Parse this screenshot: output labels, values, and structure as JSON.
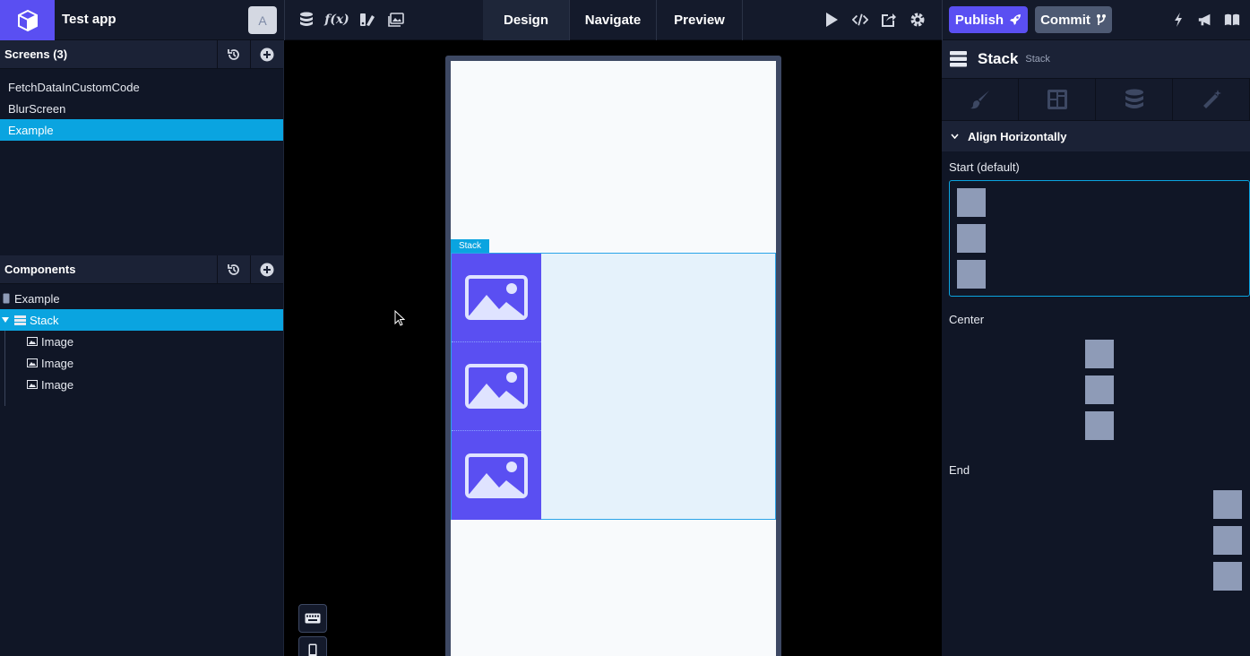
{
  "header": {
    "app_title": "Test app",
    "avatar_letter": "A",
    "tabs": [
      {
        "label": "Design",
        "active": true
      },
      {
        "label": "Navigate",
        "active": false
      },
      {
        "label": "Preview",
        "active": false
      }
    ],
    "publish_label": "Publish",
    "commit_label": "Commit"
  },
  "screens": {
    "title": "Screens (3)",
    "items": [
      {
        "label": "FetchDataInCustomCode",
        "active": false
      },
      {
        "label": "BlurScreen",
        "active": false
      },
      {
        "label": "Example",
        "active": true
      }
    ]
  },
  "components": {
    "title": "Components",
    "root": "Example",
    "stack": "Stack",
    "children": [
      "Image",
      "Image",
      "Image"
    ]
  },
  "canvas": {
    "stack_tag": "Stack"
  },
  "properties": {
    "title": "Stack",
    "subtitle": "Stack",
    "section": "Align Horizontally",
    "options": [
      {
        "label": "Start (default)",
        "selected": true
      },
      {
        "label": "Center",
        "selected": false
      },
      {
        "label": "End",
        "selected": false
      }
    ]
  },
  "colors": {
    "accent": "#5a4ff2",
    "selection": "#0aa4e0"
  }
}
